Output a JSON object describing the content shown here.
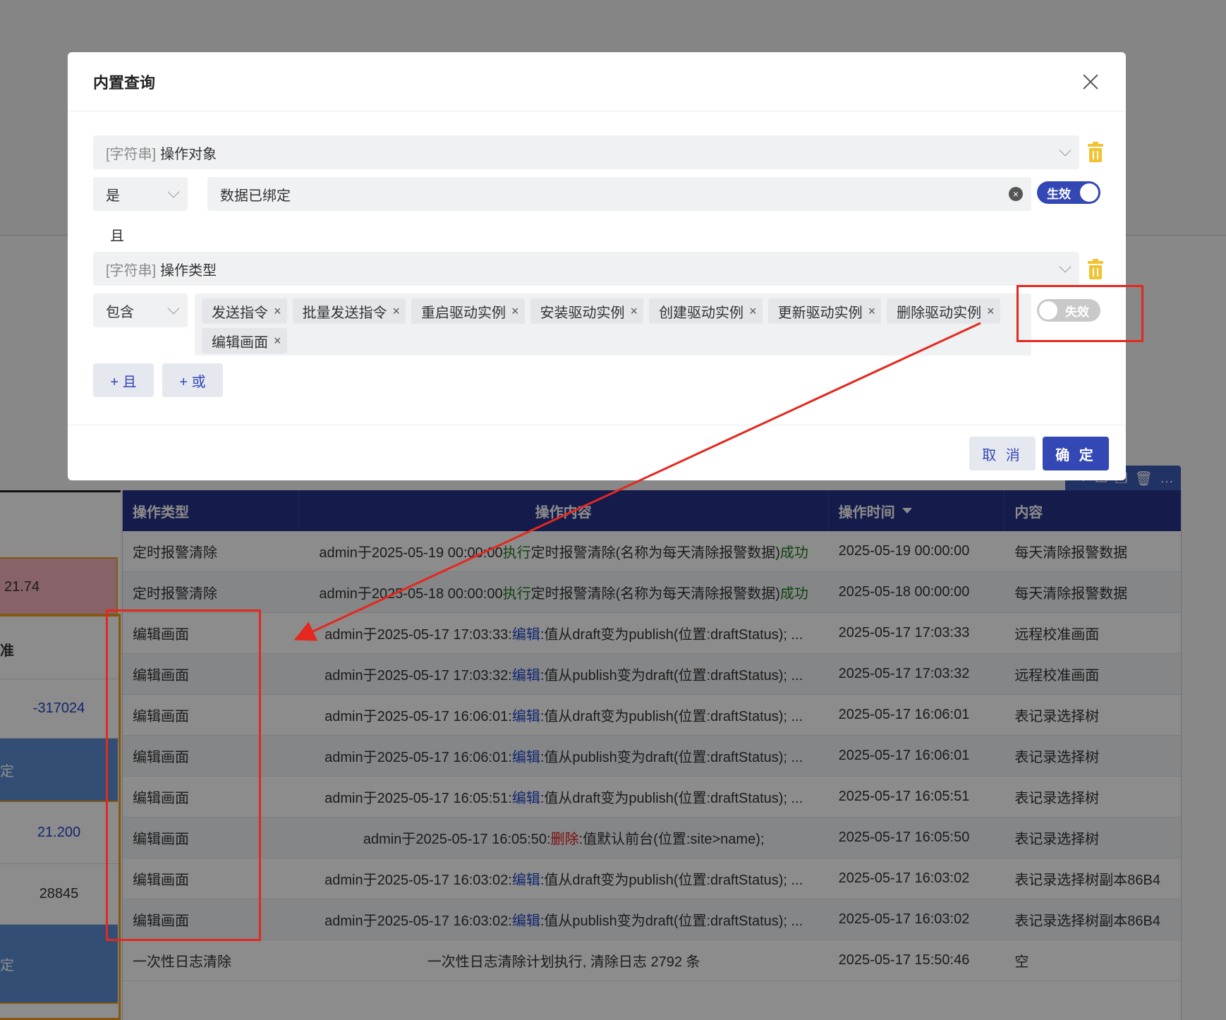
{
  "background": {
    "left_values": [
      "21.74",
      "准",
      "-317024",
      "定",
      "21.200",
      "28845",
      "定"
    ],
    "grid": {
      "columns": [
        "操作类型",
        "操作内容",
        "操作时间",
        "内容"
      ],
      "rows": [
        {
          "type": "定时报警清除",
          "content_prefix": "admin于2025-05-19 00:00:00",
          "action": "执行",
          "content_suffix": "定时报警清除(名称为每天清除报警数据)",
          "result": "成功",
          "time": "2025-05-19 00:00:00",
          "detail": "每天清除报警数据"
        },
        {
          "type": "定时报警清除",
          "content_prefix": "admin于2025-05-18 00:00:00",
          "action": "执行",
          "content_suffix": "定时报警清除(名称为每天清除报警数据)",
          "result": "成功",
          "time": "2025-05-18 00:00:00",
          "detail": "每天清除报警数据"
        },
        {
          "type": "编辑画面",
          "content_prefix": "admin于2025-05-17 17:03:33: ",
          "action": "编辑",
          "content_suffix": ":值从draft变为publish(位置:draftStatus); ...",
          "result": "",
          "time": "2025-05-17 17:03:33",
          "detail": "远程校准画面"
        },
        {
          "type": "编辑画面",
          "content_prefix": "admin于2025-05-17 17:03:32: ",
          "action": "编辑",
          "content_suffix": ":值从publish变为draft(位置:draftStatus); ...",
          "result": "",
          "time": "2025-05-17 17:03:32",
          "detail": "远程校准画面"
        },
        {
          "type": "编辑画面",
          "content_prefix": "admin于2025-05-17 16:06:01: ",
          "action": "编辑",
          "content_suffix": ":值从draft变为publish(位置:draftStatus); ...",
          "result": "",
          "time": "2025-05-17 16:06:01",
          "detail": "表记录选择树"
        },
        {
          "type": "编辑画面",
          "content_prefix": "admin于2025-05-17 16:06:01: ",
          "action": "编辑",
          "content_suffix": ":值从publish变为draft(位置:draftStatus); ...",
          "result": "",
          "time": "2025-05-17 16:06:01",
          "detail": "表记录选择树"
        },
        {
          "type": "编辑画面",
          "content_prefix": "admin于2025-05-17 16:05:51: ",
          "action": "编辑",
          "content_suffix": ":值从draft变为publish(位置:draftStatus); ...",
          "result": "",
          "time": "2025-05-17 16:05:51",
          "detail": "表记录选择树"
        },
        {
          "type": "编辑画面",
          "content_prefix": "admin于2025-05-17 16:05:50: ",
          "action": "删除",
          "content_suffix": ":值默认前台(位置:site>name);",
          "result": "",
          "time": "2025-05-17 16:05:50",
          "detail": "表记录选择树"
        },
        {
          "type": "编辑画面",
          "content_prefix": "admin于2025-05-17 16:03:02: ",
          "action": "编辑",
          "content_suffix": ":值从draft变为publish(位置:draftStatus); ...",
          "result": "",
          "time": "2025-05-17 16:03:02",
          "detail": "表记录选择树副本86B4"
        },
        {
          "type": "编辑画面",
          "content_prefix": "admin于2025-05-17 16:03:02: ",
          "action": "编辑",
          "content_suffix": ":值从publish变为draft(位置:draftStatus); ...",
          "result": "",
          "time": "2025-05-17 16:03:02",
          "detail": "表记录选择树副本86B4"
        },
        {
          "type": "一次性日志清除",
          "content_prefix": "一次性日志清除计划执行, 清除日志 2792 条",
          "action": "",
          "content_suffix": "",
          "result": "",
          "time": "2025-05-17 15:50:46",
          "detail": "空"
        }
      ]
    }
  },
  "modal": {
    "title": "内置查询",
    "condition1": {
      "field_type": "[字符串]",
      "field_name": "操作对象",
      "operator": "是",
      "value": "数据已绑定",
      "toggle_label": "生效"
    },
    "logic_label": "且",
    "condition2": {
      "field_type": "[字符串]",
      "field_name": "操作类型",
      "operator": "包含",
      "tags": [
        "发送指令",
        "批量发送指令",
        "重启驱动实例",
        "安装驱动实例",
        "创建驱动实例",
        "更新驱动实例",
        "删除驱动实例",
        "编辑画面"
      ],
      "toggle_label": "失效"
    },
    "add_and_label": "+ 且",
    "add_or_label": "+ 或",
    "cancel_label": "取 消",
    "ok_label": "确 定"
  },
  "colors": {
    "primary": "#3448b5",
    "header": "#27338a",
    "annotation": "#e5281e",
    "trash": "#f2c230"
  }
}
